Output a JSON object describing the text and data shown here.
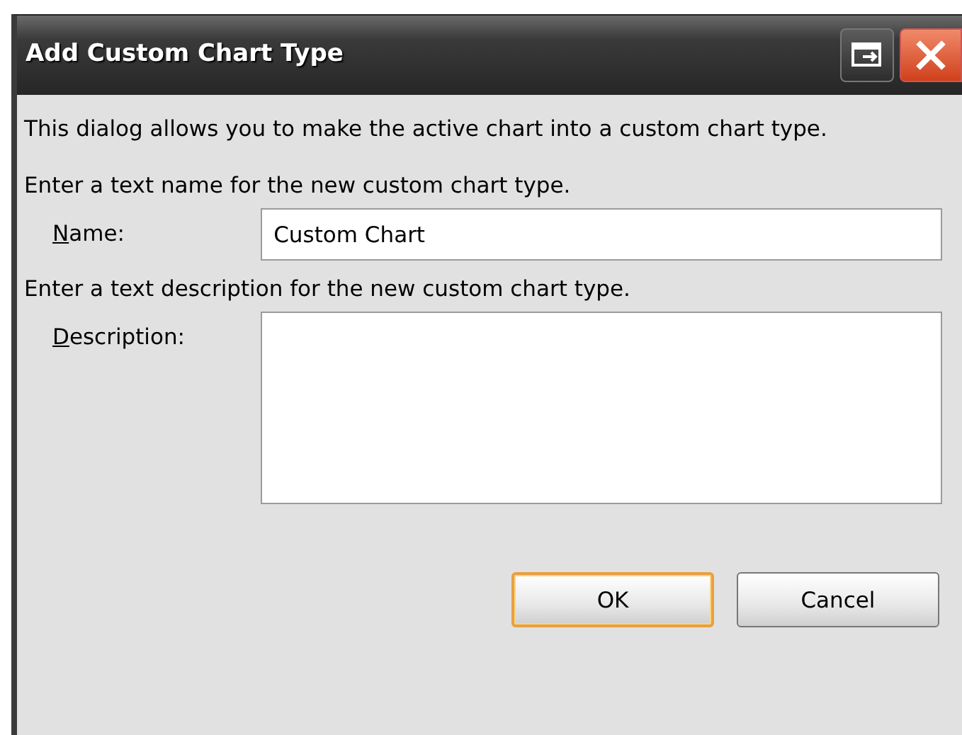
{
  "window": {
    "title": "Add Custom Chart Type"
  },
  "intro": "This dialog allows you to make the active chart into a custom chart type.",
  "name_prompt": "Enter a text name for the new custom chart type.",
  "name_field": {
    "label": "Name:",
    "access_key_underlined": true,
    "value": "Custom Chart"
  },
  "description_prompt": "Enter a text description for the new custom chart type.",
  "description_field": {
    "label": "Description:",
    "access_key_underlined": true
  },
  "buttons": [
    {
      "label": "OK",
      "default": true
    },
    {
      "label": "Cancel",
      "default": false
    }
  ]
}
